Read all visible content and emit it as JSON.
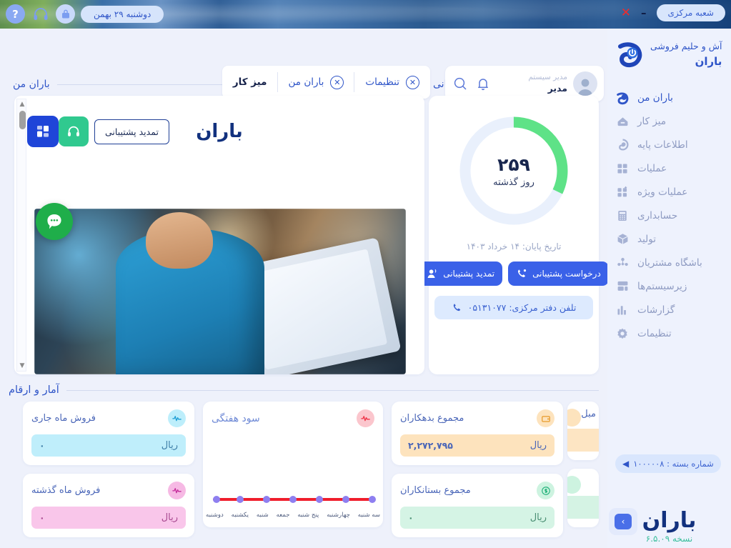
{
  "titlebar": {
    "date": "دوشنبه ۲۹ بهمن",
    "lock_icon": "lock-icon",
    "headset_icon": "headset-icon",
    "help_icon": "help-icon",
    "branch": "شعبه مرکزی",
    "minimize": "–",
    "close": "✕"
  },
  "sidebar": {
    "brand_line1": "آش و حلیم فروشی",
    "brand_line2": "باران",
    "items": [
      {
        "label": "باران من",
        "icon": "baran-drop-icon",
        "active": true
      },
      {
        "label": "میز کار",
        "icon": "desk-icon",
        "active": false
      },
      {
        "label": "اطلاعات پایه",
        "icon": "layers-icon",
        "active": false
      },
      {
        "label": "عملیات",
        "icon": "grid-icon",
        "active": false
      },
      {
        "label": "عملیات ویژه",
        "icon": "grid-plus-icon",
        "active": false
      },
      {
        "label": "حسابداری",
        "icon": "calculator-icon",
        "active": false
      },
      {
        "label": "تولید",
        "icon": "box-icon",
        "active": false
      },
      {
        "label": "باشگاه مشتریان",
        "icon": "users-network-icon",
        "active": false
      },
      {
        "label": "زیرسیستم‌ها",
        "icon": "subsystems-icon",
        "active": false
      },
      {
        "label": "گزارشات",
        "icon": "bar-chart-icon",
        "active": false
      },
      {
        "label": "تنظیمات",
        "icon": "gear-icon",
        "active": false
      }
    ],
    "package_label": "شماره بسته : ۱۰۰۰۰۰۸",
    "footer_logo": "باران",
    "version": "نسخه ۶.۵.۰۹",
    "expand_icon": "chevron-right-icon"
  },
  "tabs": [
    {
      "label": "میز کار",
      "closable": false,
      "active": true
    },
    {
      "label": "باران من",
      "closable": true,
      "active": false
    },
    {
      "label": "تنظیمات",
      "closable": true,
      "active": false
    }
  ],
  "user": {
    "role": "مدیر سیستم",
    "name": "مدیر",
    "bell_icon": "bell-icon",
    "search_icon": "search-icon",
    "avatar_icon": "avatar"
  },
  "support": {
    "section_title": "اعتبار پشتیبانی",
    "days_value": "۲۵۹",
    "days_label": "روز گذشته",
    "end_date": "تاریخ پایان: ۱۴ خرداد ۱۴۰۳",
    "renew_button": "تمدید پشتیبانی",
    "request_button": "درخواست پشتیبانی",
    "phone": "تلفن دفتر مرکزی: ۰۵۱۳۱۰۷۷",
    "ring_percent": 32,
    "ring_color": "#5ee287"
  },
  "baran_panel": {
    "section_title": "باران من",
    "grid_tile_icon": "apps-grid-icon",
    "logo_text": "باران",
    "headset_icon": "headset-icon",
    "renew_button": "تمدید پشتیبانی",
    "chat_icon": "chat-bubble-icon"
  },
  "stats": {
    "section_title": "آمار و ارقام",
    "cards": [
      {
        "title": "فروش ماه جاری",
        "currency": "ریال",
        "value": "۰",
        "icon": "pulse-icon",
        "icon_bg": "#bdeefb",
        "icon_color": "#1c9ed4",
        "val_bg": "#bfeefb",
        "val_color": "#3f7fa8"
      },
      {
        "title": "فروش ماه گذشته",
        "currency": "ریال",
        "value": "۰",
        "icon": "pulse-icon",
        "icon_bg": "#f6b9e4",
        "icon_color": "#c52c9b",
        "val_bg": "#f9c6ea",
        "val_color": "#a94a91"
      },
      {
        "title": "مجموع بدهکاران",
        "currency": "ریال",
        "value": "۲,۲۷۲,۷۹۵",
        "icon": "wallet-icon",
        "icon_bg": "#fde3bd",
        "icon_color": "#e79a2a",
        "val_bg": "#fde3bd",
        "val_color": "#4a66b8"
      },
      {
        "title": "مجموع بستانکاران",
        "currency": "ریال",
        "value": "۰",
        "icon": "dollar-icon",
        "icon_bg": "#cdf3e0",
        "icon_color": "#24b27a",
        "val_bg": "#d5f4e5",
        "val_color": "#4a8f73"
      }
    ],
    "cut_card_title": "مبل"
  },
  "chart_data": {
    "type": "line",
    "title": "سود هفتگی",
    "icon": "pulse-icon",
    "icon_bg": "#fbc6cd",
    "icon_color": "#ef3347",
    "categories": [
      "دوشنبه",
      "یکشنبه",
      "شنبه",
      "جمعه",
      "پنج شنبه",
      "چهارشنبه",
      "سه شنبه"
    ],
    "values": [
      0,
      0,
      0,
      0,
      0,
      0,
      0
    ],
    "series": [
      {
        "name": "سود هفتگی",
        "values": [
          0,
          0,
          0,
          0,
          0,
          0,
          0
        ]
      }
    ],
    "line_color": "#f01e2c",
    "point_color": "#8e7ff0",
    "ylim": [
      0,
      0
    ],
    "grid": false,
    "legend": "none",
    "xlabel": "",
    "ylabel": ""
  }
}
